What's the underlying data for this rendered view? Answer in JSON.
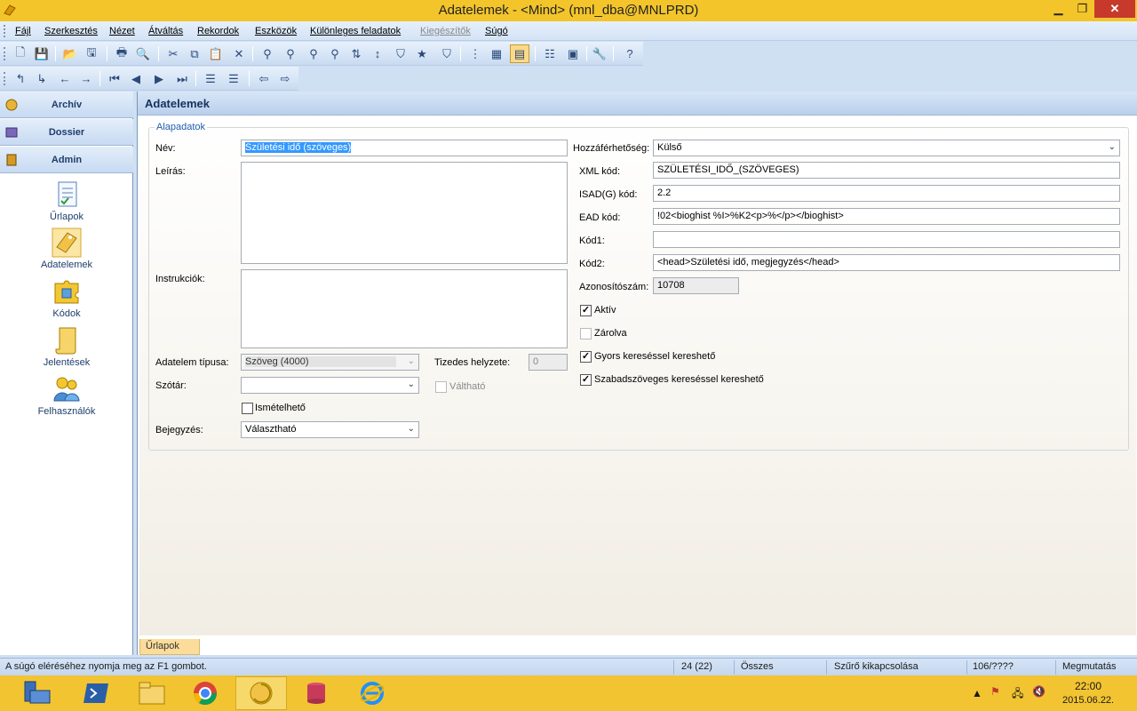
{
  "window": {
    "title": "Adatelemek - <Mind> (mnl_dba@MNLPRD)"
  },
  "menu": [
    {
      "label": "Fájl",
      "disabled": false
    },
    {
      "label": "Szerkesztés",
      "disabled": false
    },
    {
      "label": "Nézet",
      "disabled": false
    },
    {
      "label": "Átváltás",
      "disabled": false
    },
    {
      "label": "Rekordok",
      "disabled": false
    },
    {
      "label": "Eszközök",
      "disabled": false
    },
    {
      "label": "Különleges feladatok",
      "disabled": false
    },
    {
      "label": "Kiegészítők",
      "disabled": true
    },
    {
      "label": "Súgó",
      "disabled": false
    }
  ],
  "sidebar": {
    "headers": {
      "archiv": "Archív",
      "dossier": "Dossier",
      "admin": "Admin"
    },
    "items": [
      {
        "label": "Űrlapok",
        "icon": "form-icon"
      },
      {
        "label": "Adatelemek",
        "icon": "data-element-icon"
      },
      {
        "label": "Kódok",
        "icon": "puzzle-icon"
      },
      {
        "label": "Jelentések",
        "icon": "scroll-icon"
      },
      {
        "label": "Felhasználók",
        "icon": "users-icon"
      }
    ]
  },
  "main": {
    "title": "Adatelemek",
    "group_title": "Alapadatok",
    "labels": {
      "nev": "Név:",
      "leiras": "Leírás:",
      "instrukciok": "Instrukciók:",
      "adatelem_tipusa": "Adatelem típusa:",
      "szotar": "Szótár:",
      "bejegyzes": "Bejegyzés:",
      "tizedes": "Tizedes helyzete:",
      "valthato": "Váltható",
      "ismetelheto": "Ismételhető",
      "hozzaferhetoseg": "Hozzáférhetőség:",
      "xml_kod": "XML kód:",
      "isad_kod": "ISAD(G) kód:",
      "ead_kod": "EAD kód:",
      "kod1": "Kód1:",
      "kod2": "Kód2:",
      "azonosito": "Azonosítószám:",
      "aktiv": "Aktív",
      "zarolva": "Zárolva",
      "gyors": "Gyors kereséssel kereshető",
      "szabad": "Szabadszöveges kereséssel kereshető"
    },
    "values": {
      "nev": "Születési idő (szöveges)",
      "adatelem_tipusa": "Szöveg (4000)",
      "szotar": "",
      "bejegyzes": "Választható",
      "tizedes": "0",
      "hozzaferhetoseg": "Külső",
      "xml_kod": "SZÜLETÉSI_IDŐ_(SZÖVEGES)",
      "isad_kod": "2.2",
      "ead_kod": "!02<bioghist %I>%K2<p>%</p></bioghist>",
      "kod1": "",
      "kod2": "<head>Születési idő, megjegyzés</head>",
      "azonosito": "10708"
    },
    "checks": {
      "aktiv": true,
      "zarolva": false,
      "gyors": true,
      "szabad": true,
      "ismetelheto": false,
      "valthato": false
    },
    "bottom_tab": "Űrlapok"
  },
  "status": {
    "help": "A súgó eléréséhez nyomja meg az F1 gombot.",
    "record": "24 (22)",
    "scope": "Összes",
    "filter": "Szűrő kikapcsolása",
    "count": "106/????",
    "show": "Megmutatás"
  },
  "taskbar": {
    "time": "22:00",
    "date": "2015.06.22."
  },
  "colors": {
    "titlebar": "#f3c52b",
    "accent": "#1f5ea8",
    "selection": "#3399ff"
  }
}
